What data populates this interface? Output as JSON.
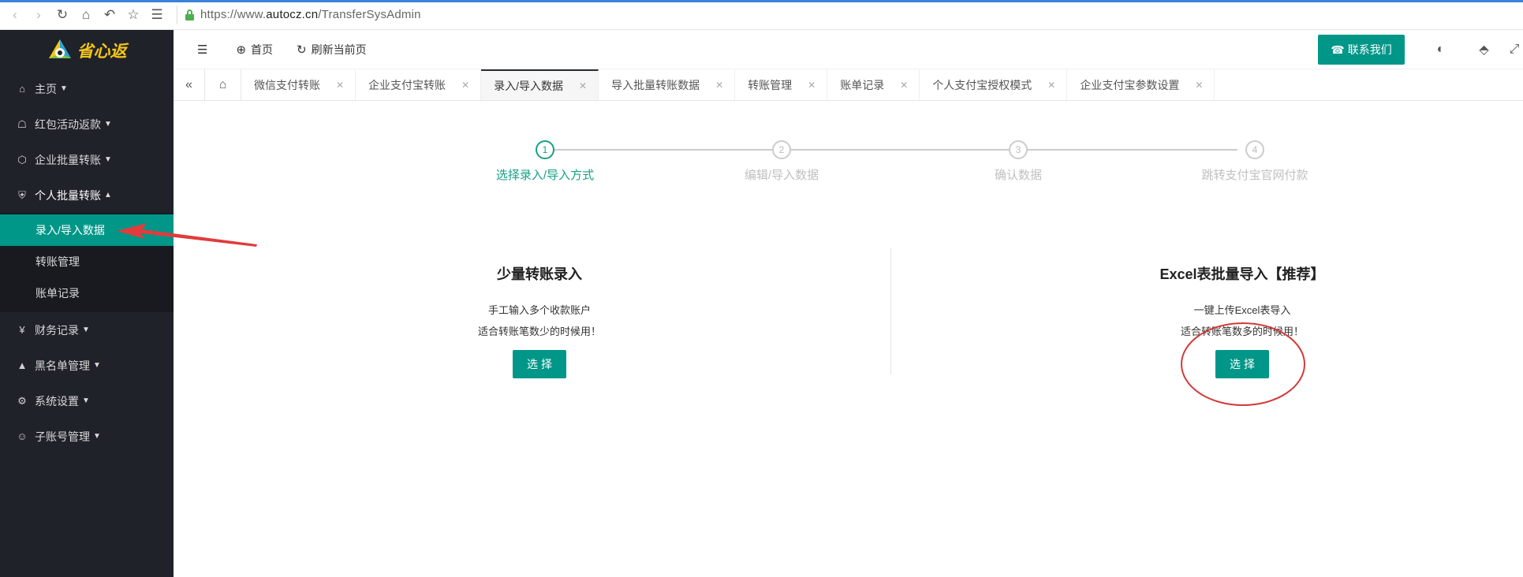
{
  "browser": {
    "url_prefix": "https://www.",
    "url_host": "autocz.cn",
    "url_path": "/TransferSysAdmin"
  },
  "sidebar": {
    "logo_text": "省心返",
    "menu": [
      {
        "label": "主页",
        "icon": "home-icon"
      },
      {
        "label": "红包活动返款",
        "icon": "gift-icon"
      },
      {
        "label": "企业批量转账",
        "icon": "box-icon"
      },
      {
        "label": "个人批量转账",
        "icon": "shield-icon"
      }
    ],
    "sub_items": [
      "录入/导入数据",
      "转账管理",
      "账单记录"
    ],
    "menu_after": [
      {
        "label": "财务记录",
        "icon": "yen-icon"
      },
      {
        "label": "黑名单管理",
        "icon": "user-icon"
      },
      {
        "label": "系统设置",
        "icon": "gear-icon"
      },
      {
        "label": "子账号管理",
        "icon": "account-icon"
      }
    ]
  },
  "header": {
    "home_label": "首页",
    "refresh_label": "刷新当前页",
    "contact_label": "联系我们"
  },
  "tabs": [
    "微信支付转账",
    "企业支付宝转账",
    "录入/导入数据",
    "导入批量转账数据",
    "转账管理",
    "账单记录",
    "个人支付宝授权模式",
    "企业支付宝参数设置"
  ],
  "active_tab_index": 2,
  "steps": [
    {
      "num": "1",
      "label": "选择录入/导入方式"
    },
    {
      "num": "2",
      "label": "编辑/导入数据"
    },
    {
      "num": "3",
      "label": "确认数据"
    },
    {
      "num": "4",
      "label": "跳转支付宝官网付款"
    }
  ],
  "active_step_index": 0,
  "cards": [
    {
      "title": "少量转账录入",
      "line1": "手工输入多个收款账户",
      "line2": "适合转账笔数少的时候用！",
      "button": "选择"
    },
    {
      "title": "Excel表批量导入【推荐】",
      "line1": "一键上传Excel表导入",
      "line2": "适合转账笔数多的时候用！",
      "button": "选择"
    }
  ],
  "colors": {
    "accent": "#009688",
    "sidebar_bg": "#20222a",
    "annotation": "#e03c3c"
  }
}
